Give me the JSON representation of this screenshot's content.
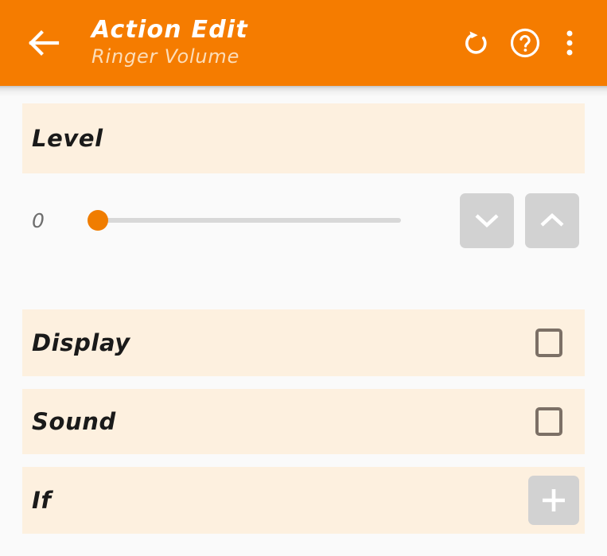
{
  "header": {
    "title": "Action Edit",
    "subtitle": "Ringer Volume",
    "back_icon": "arrow-left-icon",
    "revert_icon": "undo-icon",
    "help_icon": "help-circle-icon",
    "overflow_icon": "more-vertical-icon",
    "background_color": "#F57C00",
    "title_color": "#FFFFFF",
    "subtitle_color": "#FCDDB8"
  },
  "page": {
    "background_color": "#FAFAFA",
    "card_color": "#FDF0DF"
  },
  "rows": {
    "level": {
      "label": "Level"
    },
    "display": {
      "label": "Display",
      "checked": false,
      "checkbox_icon": "checkbox-unchecked-icon"
    },
    "sound": {
      "label": "Sound",
      "checked": false,
      "checkbox_icon": "checkbox-unchecked-icon"
    },
    "if": {
      "label": "If",
      "add_icon": "plus-icon"
    }
  },
  "slider": {
    "value": "0",
    "min": 0,
    "max": 100,
    "percent": 0,
    "thumb_color": "#F07D00",
    "track_color": "#D8D8D8",
    "decrement_icon": "chevron-down-icon",
    "increment_icon": "chevron-up-icon",
    "button_color": "#D2D2D2"
  }
}
